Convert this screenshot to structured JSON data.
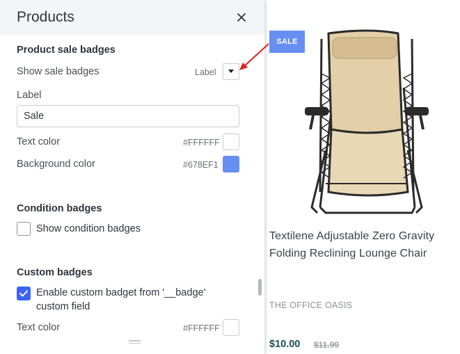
{
  "panel": {
    "title": "Products",
    "close_icon": "close-icon"
  },
  "sale_badges": {
    "section_title": "Product sale badges",
    "show_label": "Show sale badges",
    "show_value": "Label",
    "label_heading": "Label",
    "label_input_value": "Sale",
    "text_color_label": "Text color",
    "text_color_value": "#FFFFFF",
    "bg_color_label": "Background color",
    "bg_color_value": "#678EF1"
  },
  "condition_badges": {
    "section_title": "Condition badges",
    "checkbox_label": "Show condition badges",
    "checked": false
  },
  "custom_badges": {
    "section_title": "Custom badges",
    "checkbox_label_line1": "Enable custom badget from '__badge'",
    "checkbox_label_line2": "custom field",
    "checked": true,
    "text_color_label": "Text color",
    "text_color_value": "#FFFFFF"
  },
  "product": {
    "badge": "SALE",
    "title_line1": "Textilene Adjustable Zero Gravity",
    "title_line2": "Folding Reclining Lounge Chair",
    "brand": "THE OFFICE OASIS",
    "price": "$10.00",
    "old_price": "$11.99"
  },
  "colors": {
    "accent": "#3c64f4",
    "badge_bg": "#678EF1",
    "annotation_arrow": "#e02020"
  }
}
